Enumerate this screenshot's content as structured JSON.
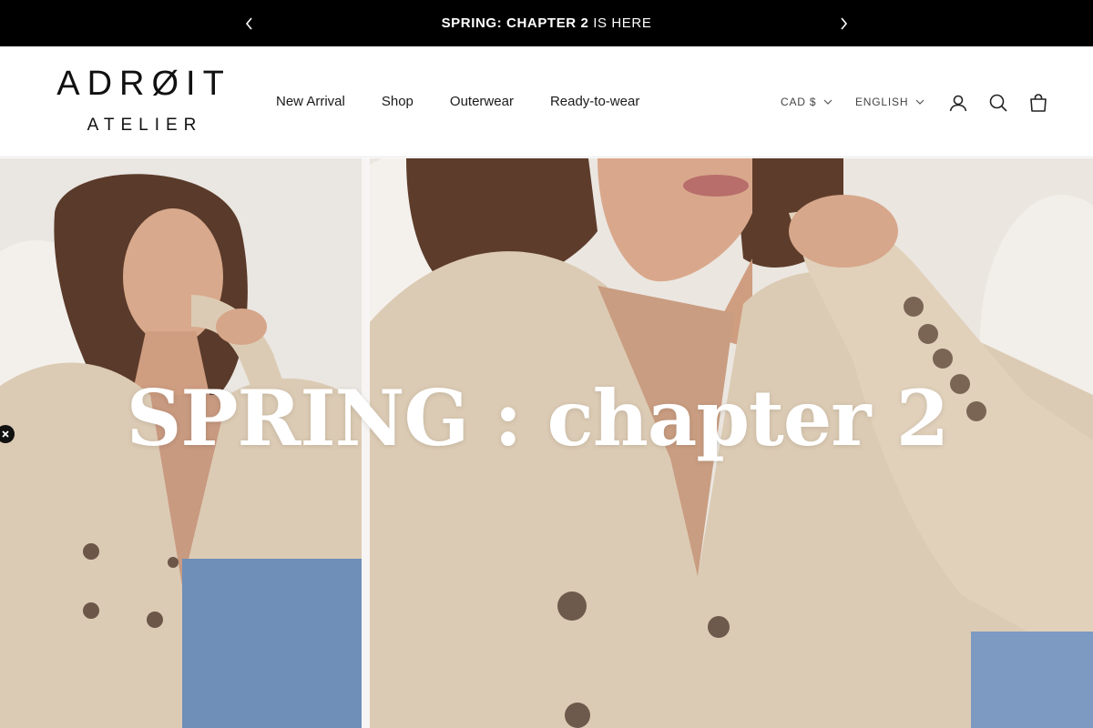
{
  "announcement": {
    "bold": "SPRING: CHAPTER 2",
    "rest": " IS HERE",
    "prev_icon": "chevron-left-icon",
    "next_icon": "chevron-right-icon"
  },
  "logo": {
    "line1": "ADRØIT",
    "line2": "ATELIER"
  },
  "nav": {
    "items": [
      {
        "label": "New Arrival"
      },
      {
        "label": "Shop"
      },
      {
        "label": "Outerwear"
      },
      {
        "label": "Ready-to-wear"
      }
    ]
  },
  "utility": {
    "currency": "CAD $",
    "language": "ENGLISH",
    "account_icon": "account-icon",
    "search_icon": "search-icon",
    "cart_icon": "cart-icon"
  },
  "hero": {
    "title": "SPRING : chapter 2"
  },
  "colors": {
    "announcement_bg": "#000000",
    "text": "#1a1a1a",
    "hero_title": "#ffffff",
    "jacket_beige": "#dccbb4"
  }
}
